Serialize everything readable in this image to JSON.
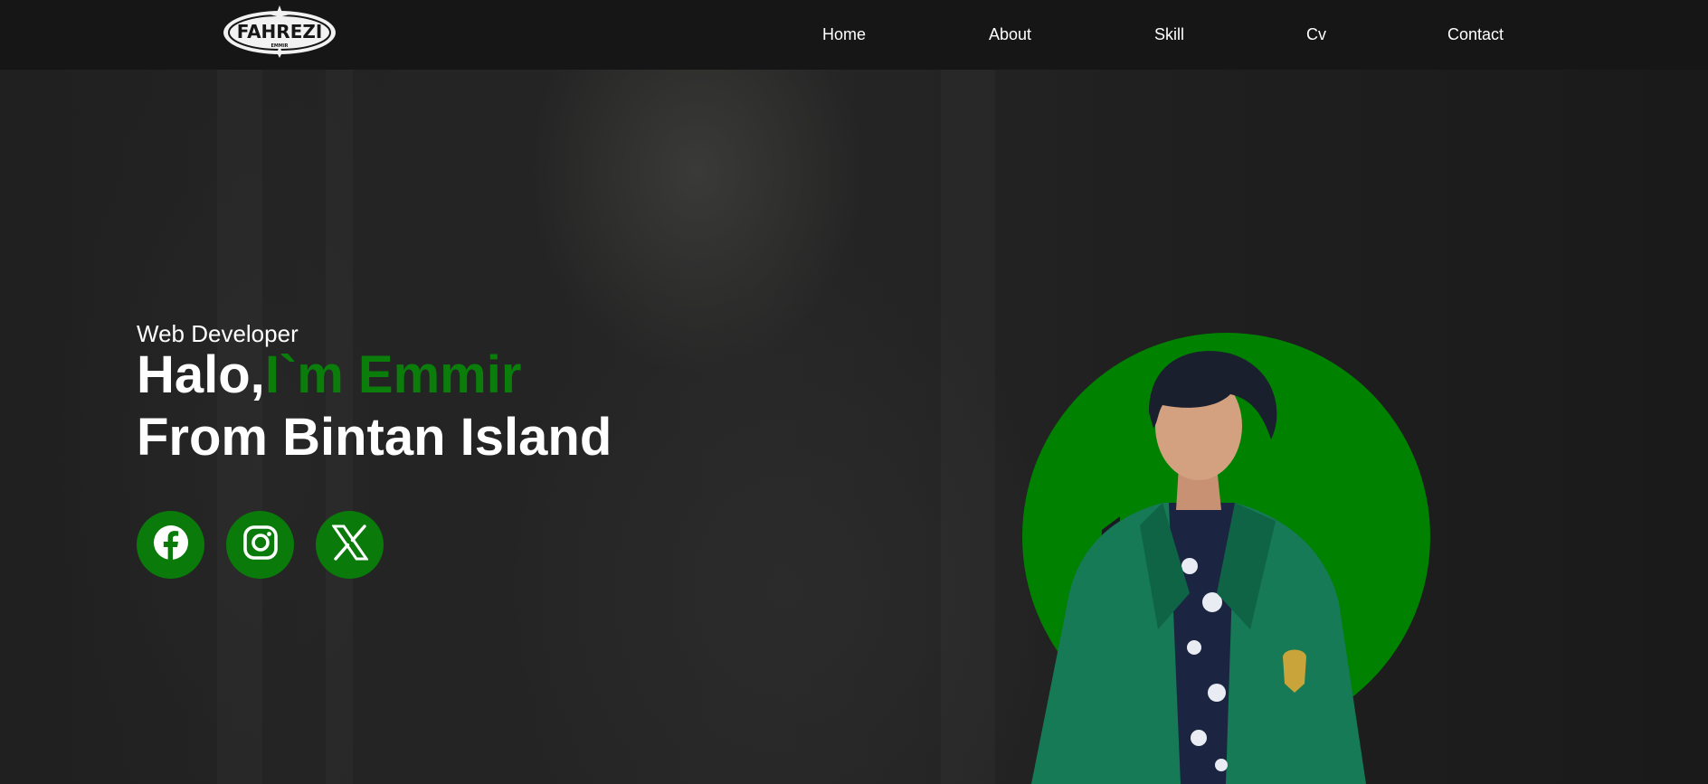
{
  "brand": {
    "logo_text": "FAHREZI",
    "logo_subtext": "EMMIR"
  },
  "nav": {
    "items": [
      {
        "label": "Home"
      },
      {
        "label": "About"
      },
      {
        "label": "Skill"
      },
      {
        "label": "Cv"
      },
      {
        "label": "Contact"
      }
    ]
  },
  "hero": {
    "subtitle": "Web Developer",
    "greeting": "Halo,",
    "name": "I`m Emmir",
    "line2": "From Bintan Island"
  },
  "social": [
    {
      "icon": "facebook-icon"
    },
    {
      "icon": "instagram-icon"
    },
    {
      "icon": "x-twitter-icon"
    }
  ],
  "colors": {
    "accent": "#0a7d0a",
    "circle": "#008100",
    "navbar": "#161616",
    "background": "#1c1c1c",
    "jacket": "#157a55"
  }
}
